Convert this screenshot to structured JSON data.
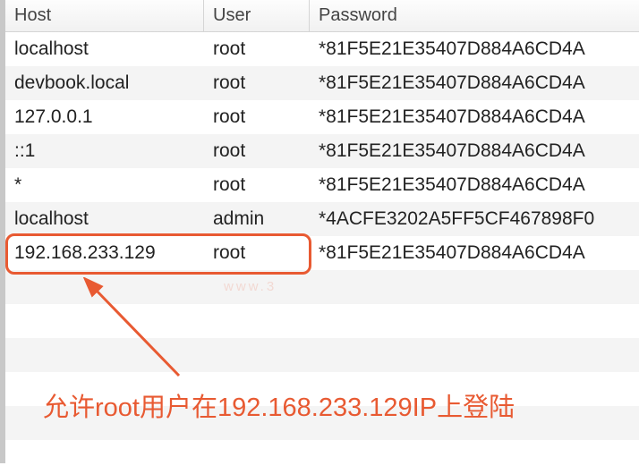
{
  "columns": {
    "host": "Host",
    "user": "User",
    "password": "Password"
  },
  "rows": [
    {
      "host": "localhost",
      "user": "root",
      "password": "*81F5E21E35407D884A6CD4A"
    },
    {
      "host": "devbook.local",
      "user": "root",
      "password": "*81F5E21E35407D884A6CD4A"
    },
    {
      "host": "127.0.0.1",
      "user": "root",
      "password": "*81F5E21E35407D884A6CD4A"
    },
    {
      "host": "::1",
      "user": "root",
      "password": "*81F5E21E35407D884A6CD4A"
    },
    {
      "host": "*",
      "user": "root",
      "password": "*81F5E21E35407D884A6CD4A"
    },
    {
      "host": "localhost",
      "user": "admin",
      "password": "*4ACFE3202A5FF5CF467898F0"
    },
    {
      "host": "192.168.233.129",
      "user": "root",
      "password": "*81F5E21E35407D884A6CD4A"
    }
  ],
  "annotation": "允许root用户在192.168.233.129IP上登陆",
  "watermark": "www.3"
}
